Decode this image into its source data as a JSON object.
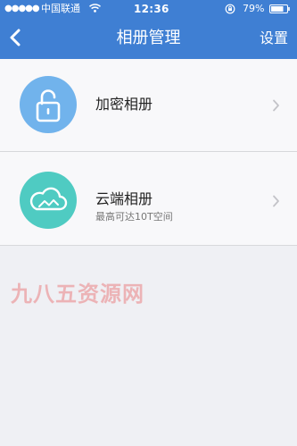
{
  "status_bar": {
    "signal": "●●●●●",
    "carrier": "中国联通",
    "time": "12:36",
    "battery": "79%"
  },
  "nav": {
    "title": "相册管理",
    "settings_label": "设置"
  },
  "albums": [
    {
      "title": "加密相册",
      "subtitle": "",
      "icon": "lock-icon",
      "icon_color": "#71b3ec"
    },
    {
      "title": "云端相册",
      "subtitle": "最高可达10T空间",
      "icon": "cloud-icon",
      "icon_color": "#4fcbc2"
    }
  ],
  "watermark": "九八五资源网",
  "colors": {
    "header": "#3f7fd3",
    "background": "#eff0f4"
  }
}
